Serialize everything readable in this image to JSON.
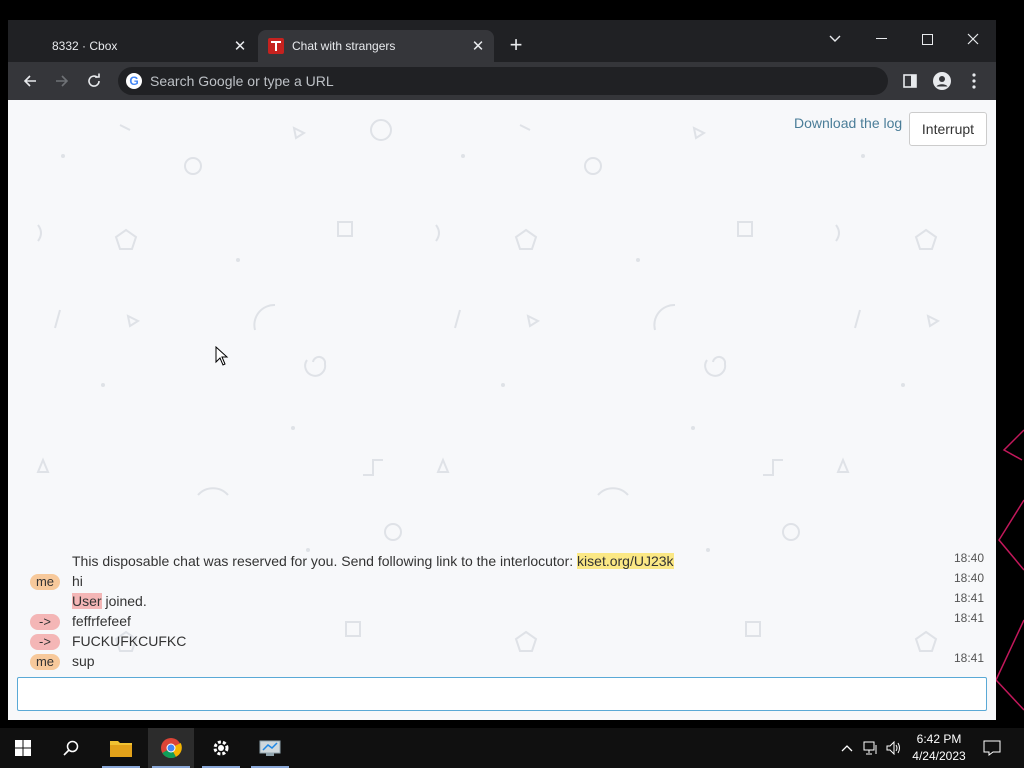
{
  "tabs": [
    {
      "title": "8332 · Cbox",
      "active": false
    },
    {
      "title": "Chat with strangers",
      "active": true
    }
  ],
  "toolbar": {
    "search_placeholder": "Search Google or type a URL"
  },
  "page": {
    "download_link": "Download the log",
    "interrupt_label": "Interrupt",
    "messages": [
      {
        "badge": "",
        "text_before": "This disposable chat was reserved for you. Send following link to the interlocutor: ",
        "link": "kiset.org/UJ23k",
        "time": "18:40"
      },
      {
        "badge": "me",
        "text": "hi",
        "time": "18:40"
      },
      {
        "badge": "",
        "user": "User",
        "text": " joined.",
        "time": "18:41"
      },
      {
        "badge": "->",
        "text": "feffrfefeef",
        "time": "18:41"
      },
      {
        "badge": "->",
        "text": "FUCKUFKCUFKC",
        "time": ""
      },
      {
        "badge": "me",
        "text": "sup",
        "time": "18:41"
      }
    ],
    "input_value": ""
  },
  "taskbar": {
    "time": "6:42 PM",
    "date": "4/24/2023"
  },
  "colors": {
    "chrome_dark": "#202124",
    "toolbar": "#35363a",
    "page_bg": "#f7f8fa",
    "me_badge": "#f7c99b",
    "arrow_badge": "#f4b6b6",
    "link_highlight": "#fbe885",
    "link_text": "#4a7d98"
  }
}
